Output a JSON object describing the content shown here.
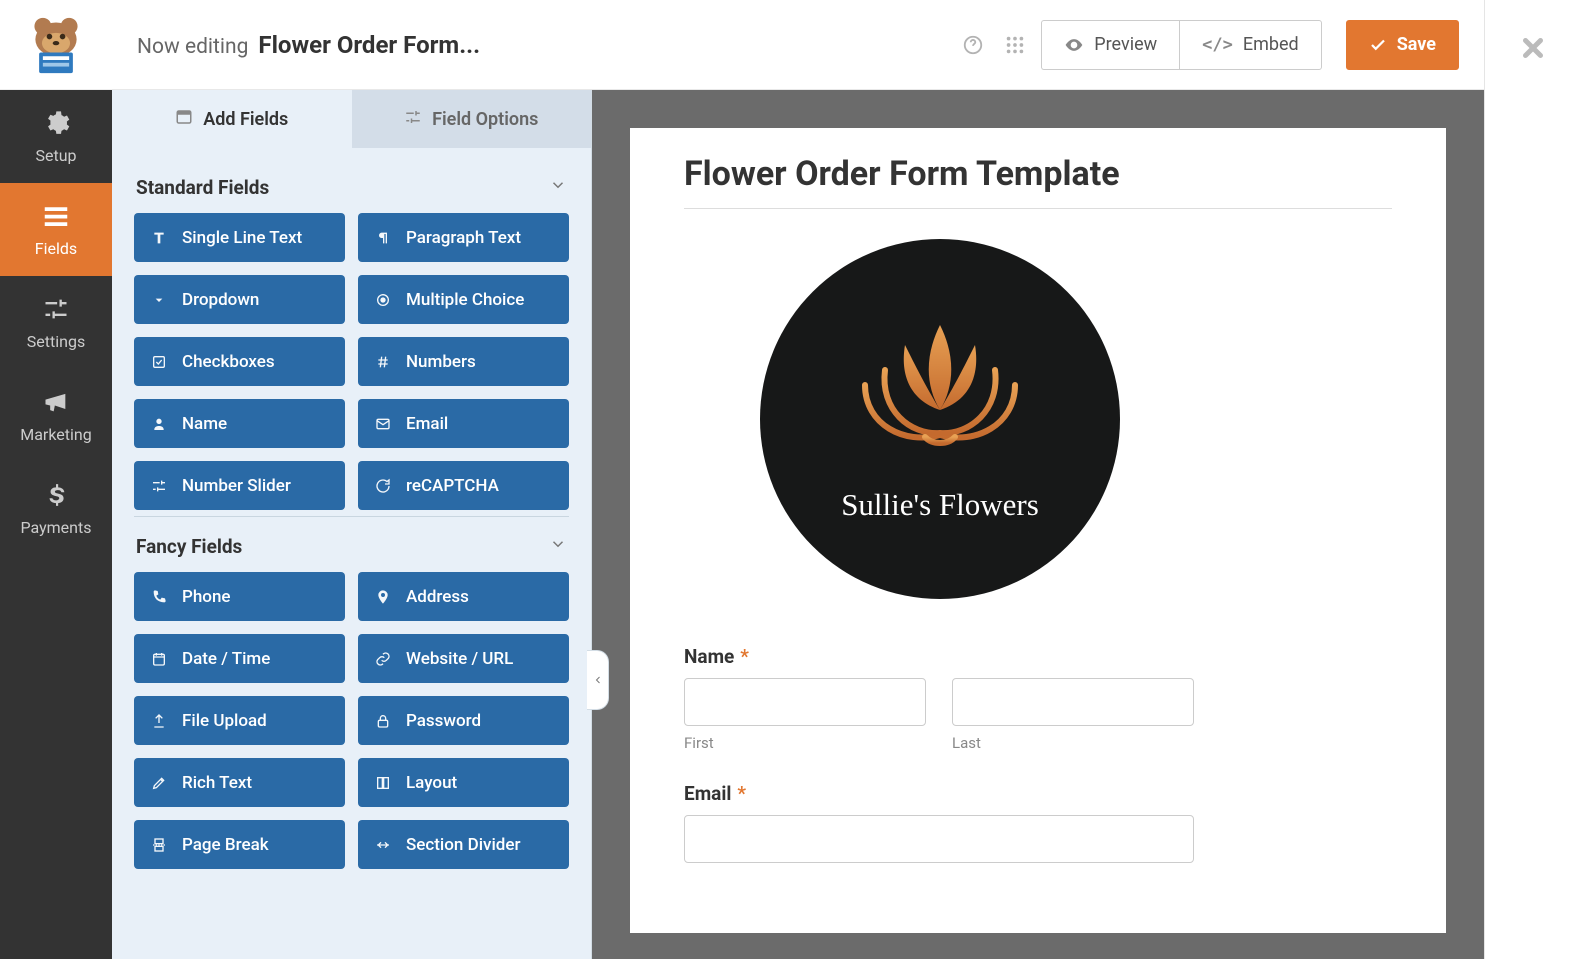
{
  "header": {
    "now_editing": "Now editing",
    "form_name": "Flower Order Form...",
    "preview": "Preview",
    "embed": "Embed",
    "save": "Save"
  },
  "left_nav": {
    "items": [
      {
        "id": "setup",
        "label": "Setup"
      },
      {
        "id": "fields",
        "label": "Fields"
      },
      {
        "id": "settings",
        "label": "Settings"
      },
      {
        "id": "marketing",
        "label": "Marketing"
      },
      {
        "id": "payments",
        "label": "Payments"
      }
    ]
  },
  "panel": {
    "tabs": {
      "add": "Add Fields",
      "options": "Field Options"
    },
    "sections": {
      "standard": {
        "title": "Standard Fields",
        "fields": [
          {
            "id": "single-line-text",
            "label": "Single Line Text",
            "icon": "text"
          },
          {
            "id": "paragraph-text",
            "label": "Paragraph Text",
            "icon": "paragraph"
          },
          {
            "id": "dropdown",
            "label": "Dropdown",
            "icon": "dropdown"
          },
          {
            "id": "multiple-choice",
            "label": "Multiple Choice",
            "icon": "radio"
          },
          {
            "id": "checkboxes",
            "label": "Checkboxes",
            "icon": "check"
          },
          {
            "id": "numbers",
            "label": "Numbers",
            "icon": "hash"
          },
          {
            "id": "name",
            "label": "Name",
            "icon": "user"
          },
          {
            "id": "email",
            "label": "Email",
            "icon": "mail"
          },
          {
            "id": "number-slider",
            "label": "Number Slider",
            "icon": "sliders"
          },
          {
            "id": "recaptcha",
            "label": "reCAPTCHA",
            "icon": "recaptcha"
          }
        ]
      },
      "fancy": {
        "title": "Fancy Fields",
        "fields": [
          {
            "id": "phone",
            "label": "Phone",
            "icon": "phone"
          },
          {
            "id": "address",
            "label": "Address",
            "icon": "pin"
          },
          {
            "id": "date-time",
            "label": "Date / Time",
            "icon": "calendar"
          },
          {
            "id": "website-url",
            "label": "Website / URL",
            "icon": "link"
          },
          {
            "id": "file-upload",
            "label": "File Upload",
            "icon": "upload"
          },
          {
            "id": "password",
            "label": "Password",
            "icon": "lock"
          },
          {
            "id": "rich-text",
            "label": "Rich Text",
            "icon": "pencil"
          },
          {
            "id": "layout",
            "label": "Layout",
            "icon": "layout"
          },
          {
            "id": "page-break",
            "label": "Page Break",
            "icon": "pagebreak"
          },
          {
            "id": "section-divider",
            "label": "Section Divider",
            "icon": "divider"
          }
        ]
      }
    }
  },
  "canvas": {
    "title": "Flower Order Form Template",
    "logo_text": "Sullie's Flowers",
    "fields": {
      "name": {
        "label": "Name",
        "first": "First",
        "last": "Last"
      },
      "email": {
        "label": "Email"
      }
    }
  },
  "colors": {
    "accent": "#e27730",
    "field_btn": "#2a6aa6"
  }
}
